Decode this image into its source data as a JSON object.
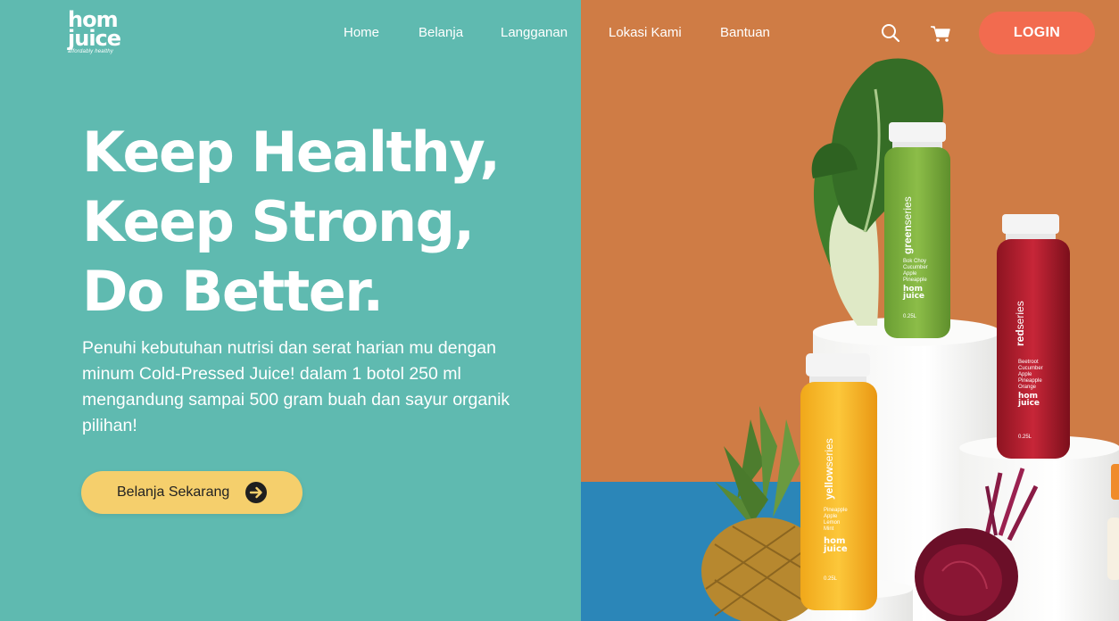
{
  "brand": {
    "name_line1": "hom",
    "name_line2": "juice",
    "tagline": "affordably healthy"
  },
  "nav": {
    "items": [
      {
        "label": "Home"
      },
      {
        "label": "Belanja"
      },
      {
        "label": "Langganan"
      },
      {
        "label": "Lokasi Kami"
      },
      {
        "label": "Bantuan"
      }
    ],
    "login_label": "LOGIN",
    "icons": [
      "search-icon",
      "cart-icon"
    ]
  },
  "hero": {
    "title_lines": [
      "Keep Healthy,",
      "Keep Strong,",
      "Do Better."
    ],
    "description": "Penuhi kebutuhan nutrisi dan serat harian mu dengan minum Cold-Pressed Juice! dalam 1 botol 250 ml mengandung sampai 500 gram buah dan sayur organik pilihan!",
    "cta_label": "Belanja Sekarang",
    "cta_icon": "arrow-right-icon"
  },
  "products": [
    {
      "series_prefix": "green",
      "series_suffix": "series",
      "ingredients": [
        "Bok Choy",
        "Cucumber",
        "Apple",
        "Pineapple"
      ],
      "volume": "0.25L",
      "brand_line1": "hom",
      "brand_line2": "juice"
    },
    {
      "series_prefix": "red",
      "series_suffix": "series",
      "ingredients": [
        "Beetroot",
        "Cucumber",
        "Apple",
        "Pineapple",
        "Orange"
      ],
      "volume": "0.25L",
      "brand_line1": "hom",
      "brand_line2": "juice"
    },
    {
      "series_prefix": "yellow",
      "series_suffix": "series",
      "ingredients": [
        "Pineapple",
        "Apple",
        "Lemon",
        "Mint"
      ],
      "volume": "0.25L",
      "brand_line1": "hom",
      "brand_line2": "juice"
    }
  ],
  "colors": {
    "left_bg": "#5fbab0",
    "right_bg": "#cf7c45",
    "floor": "#2b86b8",
    "login": "#f26b4f",
    "cta": "#f5cf6c"
  }
}
